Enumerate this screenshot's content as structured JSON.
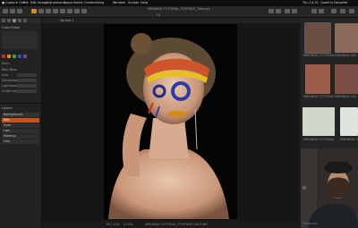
{
  "menubar": {
    "apple": "",
    "items": [
      "Capture One",
      "File",
      "Edit",
      "Image",
      "Adjustments",
      "Layer",
      "Select",
      "Camera",
      "View",
      "Window",
      "Scripts",
      "Help"
    ],
    "right_status": "Quentin Decaillet",
    "time": "Thu 14:32"
  },
  "toolbar": {
    "title": "MIRANDA TUTORIAL_PORTRAIT_Retouch",
    "zoom": "Fit",
    "session": "Capture One"
  },
  "left_panel": {
    "header": "Color Editor",
    "sub_label": "Basic",
    "section": "Skin Tone",
    "rows": [
      "Hue",
      "Saturation",
      "Lightness",
      "Uniformity"
    ],
    "section2": "Layers",
    "layer_items": [
      "Background",
      "Skin",
      "Eyes",
      "Lips",
      "Makeup",
      "Hair"
    ]
  },
  "viewer": {
    "tab_label": "Variant 1",
    "photo_caption": "MIRANDA TUTORIAL_PORTRAIT-0023.NEF",
    "status_left": "ISO 100",
    "status_right": "1/125s"
  },
  "browser": {
    "thumbs": [
      {
        "caption": "MIRANDA TUTORIAL 001"
      },
      {
        "caption": "MIRANDA 002"
      },
      {
        "caption": "MIRANDA TUTORIAL 003"
      },
      {
        "caption": "MIRANDA 004"
      },
      {
        "caption": "MIRANDA TUTORIAL 005"
      },
      {
        "caption": "MIRANDA 006"
      }
    ]
  },
  "webcam": {
    "label": "Presenter"
  },
  "colors": {
    "swatch_red": "#d8271d",
    "swatch_orange": "#e88b1c",
    "swatch_green": "#3ea24a",
    "swatch_blue": "#2b52c4",
    "swatch_purple": "#7a3fa8",
    "layer_active": "#c8531a"
  }
}
